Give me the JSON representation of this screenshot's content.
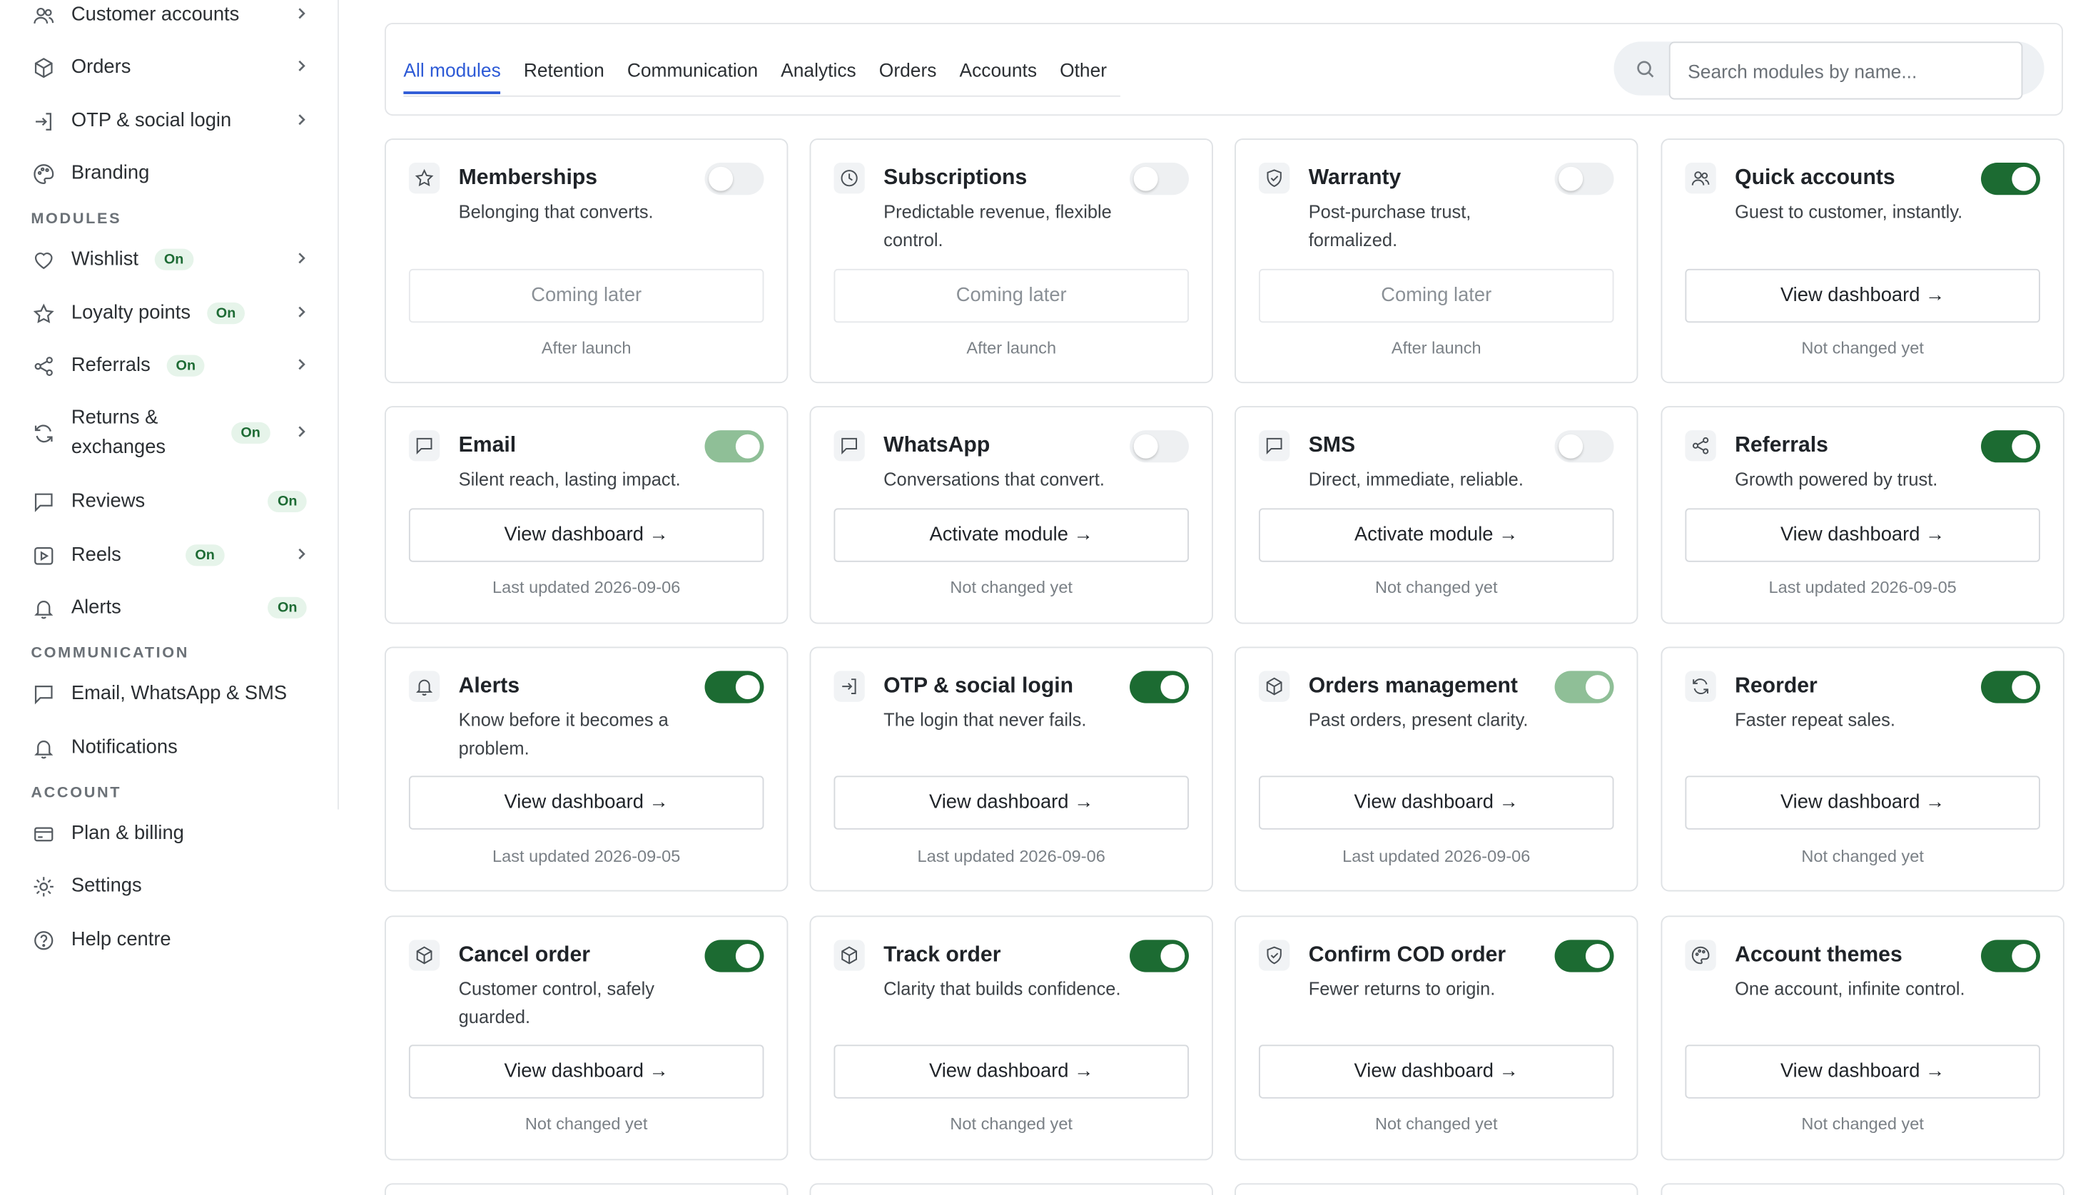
{
  "sidebar": {
    "items": [
      {
        "label": "Customer accounts",
        "icon": "users-icon",
        "badge": "",
        "chevron": true
      },
      {
        "label": "Orders",
        "icon": "box-icon",
        "badge": "",
        "chevron": true
      },
      {
        "label": "OTP & social login",
        "icon": "login-icon",
        "badge": "",
        "chevron": true
      },
      {
        "label": "Branding",
        "icon": "palette-icon",
        "badge": "",
        "chevron": false
      }
    ],
    "modules_heading": "MODULES",
    "modules": [
      {
        "label": "Wishlist",
        "icon": "heart-icon",
        "badge": "On",
        "chevron": true
      },
      {
        "label": "Loyalty points",
        "icon": "star-icon",
        "badge": "On",
        "chevron": true
      },
      {
        "label": "Referrals",
        "icon": "share-icon",
        "badge": "On",
        "chevron": true
      },
      {
        "label": "Returns & exchanges",
        "icon": "refresh-icon",
        "badge": "On",
        "chevron": true
      },
      {
        "label": "Reviews",
        "icon": "message-icon",
        "badge": "On",
        "chevron": false
      },
      {
        "label": "Reels",
        "icon": "play-icon",
        "badge": "On",
        "chevron": true
      },
      {
        "label": "Alerts",
        "icon": "bell-icon",
        "badge": "On",
        "chevron": false
      }
    ],
    "communication_heading": "COMMUNICATION",
    "communication": [
      {
        "label": "Email, WhatsApp & SMS",
        "icon": "message-icon"
      },
      {
        "label": "Notifications",
        "icon": "bell-icon"
      }
    ],
    "account_heading": "ACCOUNT",
    "account": [
      {
        "label": "Plan & billing",
        "icon": "card-icon"
      },
      {
        "label": "Settings",
        "icon": "gear-icon"
      },
      {
        "label": "Help centre",
        "icon": "help-icon"
      }
    ]
  },
  "tabs": [
    "All modules",
    "Retention",
    "Communication",
    "Analytics",
    "Orders",
    "Accounts",
    "Other"
  ],
  "active_tab": "All modules",
  "search": {
    "placeholder": "Search modules by name..."
  },
  "colors": {
    "accent": "#2d5ad6",
    "toggle_on": "#1c6b32",
    "toggle_pending": "#8fbf97",
    "badge_bg": "#e6f4ea"
  },
  "cards": [
    {
      "title": "Memberships",
      "desc": "Belonging that converts.",
      "icon": "star-icon",
      "toggle": "off",
      "button": "Coming later",
      "button_state": "disabled",
      "footer": "After launch"
    },
    {
      "title": "Subscriptions",
      "desc": "Predictable revenue, flexible control.",
      "icon": "clock-icon",
      "toggle": "off",
      "button": "Coming later",
      "button_state": "disabled",
      "footer": "After launch"
    },
    {
      "title": "Warranty",
      "desc": "Post-purchase trust, formalized.",
      "icon": "shield-icon",
      "toggle": "off",
      "button": "Coming later",
      "button_state": "disabled",
      "footer": "After launch"
    },
    {
      "title": "Quick accounts",
      "desc": "Guest to customer, instantly.",
      "icon": "users-icon",
      "toggle": "on",
      "button": "View dashboard →",
      "button_state": "normal",
      "footer": "Not changed yet"
    },
    {
      "title": "Email",
      "desc": "Silent reach, lasting impact.",
      "icon": "message-icon",
      "toggle": "pending",
      "button": "View dashboard →",
      "button_state": "normal",
      "footer": "Last updated 2026-09-06"
    },
    {
      "title": "WhatsApp",
      "desc": "Conversations that convert.",
      "icon": "message-icon",
      "toggle": "off",
      "button": "Activate module →",
      "button_state": "normal",
      "footer": "Not changed yet"
    },
    {
      "title": "SMS",
      "desc": "Direct, immediate, reliable.",
      "icon": "message-icon",
      "toggle": "off",
      "button": "Activate module →",
      "button_state": "normal",
      "footer": "Not changed yet"
    },
    {
      "title": "Referrals",
      "desc": "Growth powered by trust.",
      "icon": "share-icon",
      "toggle": "on",
      "button": "View dashboard →",
      "button_state": "normal",
      "footer": "Last updated 2026-09-05"
    },
    {
      "title": "Alerts",
      "desc": "Know before it becomes a problem.",
      "icon": "bell-icon",
      "toggle": "on",
      "button": "View dashboard →",
      "button_state": "normal",
      "footer": "Last updated 2026-09-05"
    },
    {
      "title": "OTP & social login",
      "desc": "The login that never fails.",
      "icon": "login-icon",
      "toggle": "on",
      "button": "View dashboard →",
      "button_state": "normal",
      "footer": "Last updated 2026-09-06"
    },
    {
      "title": "Orders management",
      "desc": "Past orders, present clarity.",
      "icon": "box-icon",
      "toggle": "pending",
      "button": "View dashboard →",
      "button_state": "normal",
      "footer": "Last updated 2026-09-06"
    },
    {
      "title": "Reorder",
      "desc": "Faster repeat sales.",
      "icon": "refresh-icon",
      "toggle": "on",
      "button": "View dashboard →",
      "button_state": "normal",
      "footer": "Not changed yet"
    },
    {
      "title": "Cancel order",
      "desc": "Customer control, safely guarded.",
      "icon": "box-icon",
      "toggle": "on",
      "button": "View dashboard →",
      "button_state": "normal",
      "footer": "Not changed yet"
    },
    {
      "title": "Track order",
      "desc": "Clarity that builds confidence.",
      "icon": "box-icon",
      "toggle": "on",
      "button": "View dashboard →",
      "button_state": "normal",
      "footer": "Not changed yet"
    },
    {
      "title": "Confirm COD order",
      "desc": "Fewer returns to origin.",
      "icon": "shield-icon",
      "toggle": "on",
      "button": "View dashboard →",
      "button_state": "normal",
      "footer": "Not changed yet"
    },
    {
      "title": "Account themes",
      "desc": "One account, infinite control.",
      "icon": "palette-icon",
      "toggle": "on",
      "button": "View dashboard →",
      "button_state": "normal",
      "footer": "Not changed yet"
    }
  ]
}
